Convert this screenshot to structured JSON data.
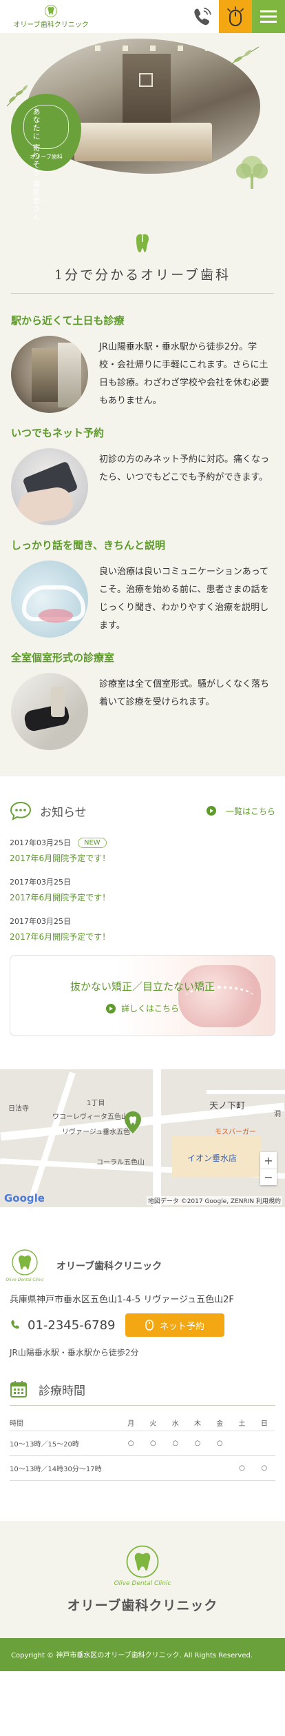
{
  "header": {
    "logo_text": "オリーブ歯科クリニック"
  },
  "hero": {
    "badge_lines": [
      "あなたに",
      "寄りそう",
      "歯医者さん"
    ],
    "badge_name": "オリーブ歯科"
  },
  "intro": {
    "title": "1分で分かるオリーブ歯科",
    "features": [
      {
        "title": "駅から近くて土日も診療",
        "text": "JR山陽垂水駅・垂水駅から徒歩2分。学校・会社帰りに手軽にこれます。さらに土日も診療。わざわざ学校や会社を休む必要もありません。"
      },
      {
        "title": "いつでもネット予約",
        "text": "初診の方のみネット予約に対応。痛くなったら、いつでもどこでも予約ができます。"
      },
      {
        "title": "しっかり話を聞き、きちんと説明",
        "text": "良い治療は良いコミュニケーションあってこそ。治療を始める前に、患者さまの話をじっくり聞き、わかりやすく治療を説明します。"
      },
      {
        "title": "全室個室形式の診療室",
        "text": "診療室は全て個室形式。騒がしくなく落ち着いて診療を受けられます。"
      }
    ]
  },
  "news": {
    "title": "お知らせ",
    "more_label": "一覧はこちら",
    "items": [
      {
        "date": "2017年03月25日",
        "badge": "NEW",
        "text": "2017年6月開院予定です！"
      },
      {
        "date": "2017年03月25日",
        "badge": "",
        "text": "2017年6月開院予定です！"
      },
      {
        "date": "2017年03月25日",
        "badge": "",
        "text": "2017年6月開院予定です！"
      }
    ],
    "banner_title": "抜かない矯正／目立たない矯正",
    "banner_link": "詳しくはこちら"
  },
  "map": {
    "labels": [
      "日法寺",
      "1丁目",
      "ワコーレヴィータ五色山",
      "リヴァージュ垂水五色",
      "天ノ下町",
      "モスバーガー",
      "コーラル五色山",
      "イオン垂水店",
      "洞"
    ],
    "zoom_in": "+",
    "zoom_out": "−",
    "google": "Google",
    "attribution": "地図データ ©2017 Google, ZENRIN   利用規約"
  },
  "clinic": {
    "logo_sub": "Olive Dental Clinic",
    "name": "オリーブ歯科クリニック",
    "address": "兵庫県神戸市垂水区五色山1-4-5 リヴァージュ五色山2F",
    "tel": "01-2345-6789",
    "net_button": "ネット予約",
    "access": "JR山陽垂水駅・垂水駅から徒歩2分"
  },
  "hours": {
    "title": "診療時間",
    "columns": [
      "時間",
      "月",
      "火",
      "水",
      "木",
      "金",
      "土",
      "日"
    ],
    "rows": [
      [
        "10～13時／15～20時",
        "○",
        "○",
        "○",
        "○",
        "○",
        "",
        ""
      ],
      [
        "10～13時／14時30分～17時",
        "",
        "",
        "",
        "",
        "",
        "○",
        "○"
      ]
    ]
  },
  "footer": {
    "logo_sub": "Olive Dental Clinic",
    "name": "オリーブ歯科クリニック",
    "copyright": "Copyright © 神戸市垂水区のオリーブ歯科クリニック. All Rights Reserved."
  },
  "colors": {
    "green": "#6aa13a",
    "text_green": "#5e9a2c",
    "orange": "#f3a712",
    "cream": "#f4f3ec"
  }
}
